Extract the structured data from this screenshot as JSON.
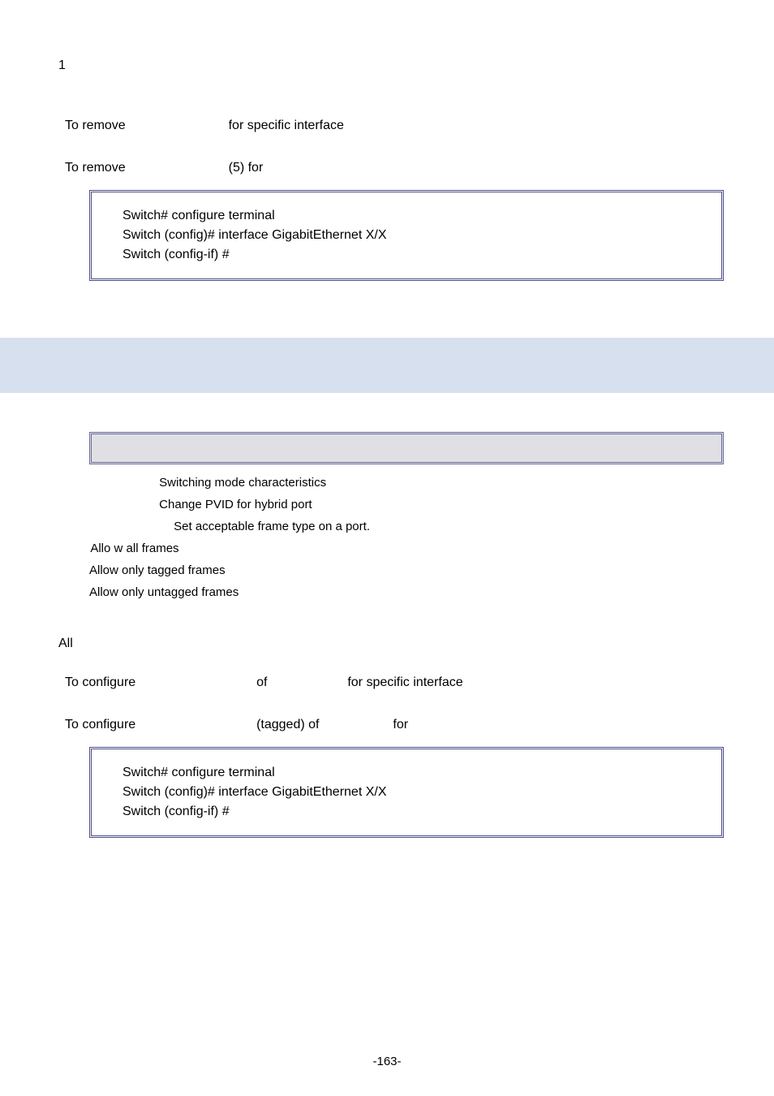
{
  "top_num": "1",
  "usage1": {
    "a": "To remove",
    "b": "for specific interface"
  },
  "example1": {
    "a": "To remove",
    "b": "(5) for"
  },
  "box1": {
    "l1": "Switch# configure terminal",
    "l2": "Switch (config)# interface GigabitEthernet X/X",
    "l3": "Switch (config-if) #"
  },
  "syntax": {
    "s1": "Switching mode characteristics",
    "s2": "Change PVID for hybrid port",
    "s3": "Set acceptable frame type on a port.",
    "s4": "Allo w all frames",
    "s5": "Allow only tagged frames",
    "s6": "Allow only untagged frames"
  },
  "default_val": "All",
  "usage2": {
    "a": "To configure",
    "b": "of",
    "c": "for specific interface"
  },
  "example2": {
    "a": "To configure",
    "b": "(tagged) of",
    "c": "for"
  },
  "box2": {
    "l1": "Switch# configure terminal",
    "l2": "Switch (config)# interface GigabitEthernet X/X",
    "l3": "Switch (config-if) #"
  },
  "page": "-163-"
}
